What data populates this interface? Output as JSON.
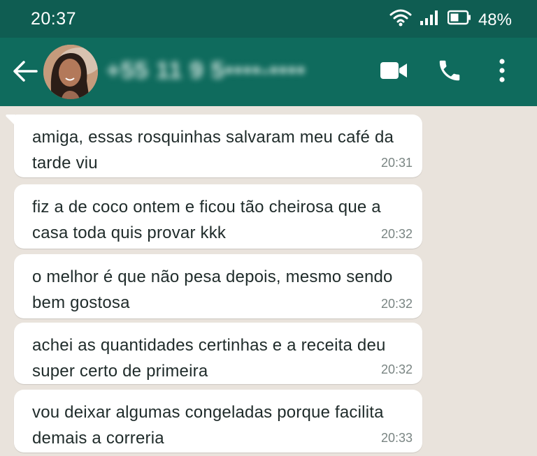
{
  "status_bar": {
    "time": "20:37",
    "battery": "48%",
    "icons": [
      "wifi-icon",
      "signal-icon",
      "battery-icon"
    ]
  },
  "header": {
    "contact_name": "+55 11 9 5••••-••••",
    "icons": [
      "back-arrow-icon",
      "video-call-icon",
      "phone-icon",
      "more-options-icon"
    ],
    "color": "#0f6b5d"
  },
  "messages": [
    {
      "text": "amiga, essas rosquinhas salvaram meu café da tarde viu",
      "time": "20:31"
    },
    {
      "text": "fiz a de coco ontem e ficou tão cheirosa que a casa toda quis provar kkk",
      "time": "20:32"
    },
    {
      "text": "o melhor é que não pesa depois, mesmo sendo bem gostosa",
      "time": "20:32"
    },
    {
      "text": "achei as quantidades certinhas e a receita deu super certo de primeira",
      "time": "20:32"
    },
    {
      "text": "vou deixar algumas congeladas porque facilita demais a correria",
      "time": "20:33"
    }
  ]
}
